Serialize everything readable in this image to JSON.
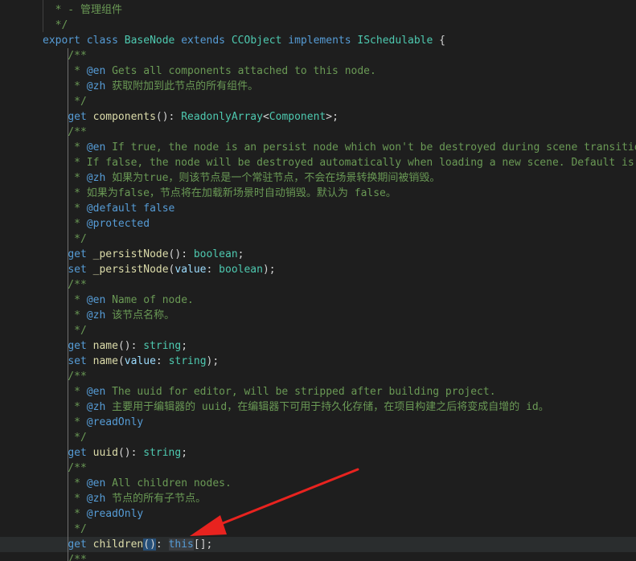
{
  "colors": {
    "background": "#1e1e1e",
    "keyword": "#569cd6",
    "type": "#4ec9b0",
    "function": "#dcdcaa",
    "variable": "#9cdcfe",
    "comment": "#6a9955",
    "text": "#d4d4d4",
    "arrow": "#e8231f"
  },
  "lines": [
    {
      "tokens": [
        {
          "t": "cmt",
          "v": "  * - 管理组件"
        }
      ]
    },
    {
      "tokens": [
        {
          "t": "cmt",
          "v": "  */"
        }
      ]
    },
    {
      "tokens": [
        {
          "t": "kw",
          "v": "export"
        },
        {
          "t": "punc",
          "v": " "
        },
        {
          "t": "kw",
          "v": "class"
        },
        {
          "t": "punc",
          "v": " "
        },
        {
          "t": "type",
          "v": "BaseNode"
        },
        {
          "t": "punc",
          "v": " "
        },
        {
          "t": "kw",
          "v": "extends"
        },
        {
          "t": "punc",
          "v": " "
        },
        {
          "t": "type",
          "v": "CCObject"
        },
        {
          "t": "punc",
          "v": " "
        },
        {
          "t": "kw",
          "v": "implements"
        },
        {
          "t": "punc",
          "v": " "
        },
        {
          "t": "type",
          "v": "ISchedulable"
        },
        {
          "t": "punc",
          "v": " {"
        }
      ]
    },
    {
      "tokens": [
        {
          "t": "cmt",
          "v": "    /**"
        }
      ]
    },
    {
      "tokens": [
        {
          "t": "cmt",
          "v": "     * "
        },
        {
          "t": "tag",
          "v": "@en"
        },
        {
          "t": "cmt",
          "v": " Gets all components attached to this node."
        }
      ]
    },
    {
      "tokens": [
        {
          "t": "cmt",
          "v": "     * "
        },
        {
          "t": "tag",
          "v": "@zh"
        },
        {
          "t": "cmt",
          "v": " 获取附加到此节点的所有组件。"
        }
      ]
    },
    {
      "tokens": [
        {
          "t": "cmt",
          "v": "     */"
        }
      ]
    },
    {
      "tokens": [
        {
          "t": "punc",
          "v": "    "
        },
        {
          "t": "kw",
          "v": "get"
        },
        {
          "t": "punc",
          "v": " "
        },
        {
          "t": "fn",
          "v": "components"
        },
        {
          "t": "punc",
          "v": "(): "
        },
        {
          "t": "type",
          "v": "ReadonlyArray"
        },
        {
          "t": "punc",
          "v": "<"
        },
        {
          "t": "type",
          "v": "Component"
        },
        {
          "t": "punc",
          "v": ">;"
        }
      ]
    },
    {
      "tokens": [
        {
          "t": "cmt",
          "v": "    /**"
        }
      ]
    },
    {
      "tokens": [
        {
          "t": "cmt",
          "v": "     * "
        },
        {
          "t": "tag",
          "v": "@en"
        },
        {
          "t": "cmt",
          "v": " If true, the node is an persist node which won't be destroyed during scene transition."
        }
      ]
    },
    {
      "tokens": [
        {
          "t": "cmt",
          "v": "     * If false, the node will be destroyed automatically when loading a new scene. Default is false."
        }
      ]
    },
    {
      "tokens": [
        {
          "t": "cmt",
          "v": "     * "
        },
        {
          "t": "tag",
          "v": "@zh"
        },
        {
          "t": "cmt",
          "v": " 如果为true，则该节点是一个常驻节点，不会在场景转换期间被销毁。"
        }
      ]
    },
    {
      "tokens": [
        {
          "t": "cmt",
          "v": "     * 如果为false，节点将在加载新场景时自动销毁。默认为 false。"
        }
      ]
    },
    {
      "tokens": [
        {
          "t": "cmt",
          "v": "     * "
        },
        {
          "t": "tag",
          "v": "@default"
        },
        {
          "t": "punc",
          "v": " "
        },
        {
          "t": "kw",
          "v": "false"
        }
      ]
    },
    {
      "tokens": [
        {
          "t": "cmt",
          "v": "     * "
        },
        {
          "t": "tag",
          "v": "@protected"
        }
      ]
    },
    {
      "tokens": [
        {
          "t": "cmt",
          "v": "     */"
        }
      ]
    },
    {
      "tokens": [
        {
          "t": "punc",
          "v": "    "
        },
        {
          "t": "kw",
          "v": "get"
        },
        {
          "t": "punc",
          "v": " "
        },
        {
          "t": "fn",
          "v": "_persistNode"
        },
        {
          "t": "punc",
          "v": "(): "
        },
        {
          "t": "type",
          "v": "boolean"
        },
        {
          "t": "punc",
          "v": ";"
        }
      ]
    },
    {
      "tokens": [
        {
          "t": "punc",
          "v": "    "
        },
        {
          "t": "kw",
          "v": "set"
        },
        {
          "t": "punc",
          "v": " "
        },
        {
          "t": "fn",
          "v": "_persistNode"
        },
        {
          "t": "punc",
          "v": "("
        },
        {
          "t": "var",
          "v": "value"
        },
        {
          "t": "punc",
          "v": ": "
        },
        {
          "t": "type",
          "v": "boolean"
        },
        {
          "t": "punc",
          "v": ");"
        }
      ]
    },
    {
      "tokens": [
        {
          "t": "cmt",
          "v": "    /**"
        }
      ]
    },
    {
      "tokens": [
        {
          "t": "cmt",
          "v": "     * "
        },
        {
          "t": "tag",
          "v": "@en"
        },
        {
          "t": "cmt",
          "v": " Name of node."
        }
      ]
    },
    {
      "tokens": [
        {
          "t": "cmt",
          "v": "     * "
        },
        {
          "t": "tag",
          "v": "@zh"
        },
        {
          "t": "cmt",
          "v": " 该节点名称。"
        }
      ]
    },
    {
      "tokens": [
        {
          "t": "cmt",
          "v": "     */"
        }
      ]
    },
    {
      "tokens": [
        {
          "t": "punc",
          "v": "    "
        },
        {
          "t": "kw",
          "v": "get"
        },
        {
          "t": "punc",
          "v": " "
        },
        {
          "t": "fn",
          "v": "name"
        },
        {
          "t": "punc",
          "v": "(): "
        },
        {
          "t": "type",
          "v": "string"
        },
        {
          "t": "punc",
          "v": ";"
        }
      ]
    },
    {
      "tokens": [
        {
          "t": "punc",
          "v": "    "
        },
        {
          "t": "kw",
          "v": "set"
        },
        {
          "t": "punc",
          "v": " "
        },
        {
          "t": "fn",
          "v": "name"
        },
        {
          "t": "punc",
          "v": "("
        },
        {
          "t": "var",
          "v": "value"
        },
        {
          "t": "punc",
          "v": ": "
        },
        {
          "t": "type",
          "v": "string"
        },
        {
          "t": "punc",
          "v": ");"
        }
      ]
    },
    {
      "tokens": [
        {
          "t": "cmt",
          "v": "    /**"
        }
      ]
    },
    {
      "tokens": [
        {
          "t": "cmt",
          "v": "     * "
        },
        {
          "t": "tag",
          "v": "@en"
        },
        {
          "t": "cmt",
          "v": " The uuid for editor, will be stripped after building project."
        }
      ]
    },
    {
      "tokens": [
        {
          "t": "cmt",
          "v": "     * "
        },
        {
          "t": "tag",
          "v": "@zh"
        },
        {
          "t": "cmt",
          "v": " 主要用于编辑器的 uuid，在编辑器下可用于持久化存储，在项目构建之后将变成自增的 id。"
        }
      ]
    },
    {
      "tokens": [
        {
          "t": "cmt",
          "v": "     * "
        },
        {
          "t": "tag",
          "v": "@readOnly"
        }
      ]
    },
    {
      "tokens": [
        {
          "t": "cmt",
          "v": "     */"
        }
      ]
    },
    {
      "tokens": [
        {
          "t": "punc",
          "v": "    "
        },
        {
          "t": "kw",
          "v": "get"
        },
        {
          "t": "punc",
          "v": " "
        },
        {
          "t": "fn",
          "v": "uuid"
        },
        {
          "t": "punc",
          "v": "(): "
        },
        {
          "t": "type",
          "v": "string"
        },
        {
          "t": "punc",
          "v": ";"
        }
      ]
    },
    {
      "tokens": [
        {
          "t": "cmt",
          "v": "    /**"
        }
      ]
    },
    {
      "tokens": [
        {
          "t": "cmt",
          "v": "     * "
        },
        {
          "t": "tag",
          "v": "@en"
        },
        {
          "t": "cmt",
          "v": " All children nodes."
        }
      ]
    },
    {
      "tokens": [
        {
          "t": "cmt",
          "v": "     * "
        },
        {
          "t": "tag",
          "v": "@zh"
        },
        {
          "t": "cmt",
          "v": " 节点的所有子节点。"
        }
      ]
    },
    {
      "tokens": [
        {
          "t": "cmt",
          "v": "     * "
        },
        {
          "t": "tag",
          "v": "@readOnly"
        }
      ]
    },
    {
      "tokens": [
        {
          "t": "cmt",
          "v": "     */"
        }
      ]
    },
    {
      "highlight": true,
      "tokens": [
        {
          "t": "punc",
          "v": "    "
        },
        {
          "t": "kw",
          "v": "get"
        },
        {
          "t": "punc",
          "v": " "
        },
        {
          "t": "fn",
          "v": "children"
        },
        {
          "t": "sel",
          "v": "()"
        },
        {
          "t": "punc",
          "v": ": "
        },
        {
          "t": "kwhl",
          "v": "this"
        },
        {
          "t": "punc",
          "v": "[];"
        }
      ]
    },
    {
      "tokens": [
        {
          "t": "cmt",
          "v": "    /**"
        }
      ]
    }
  ]
}
